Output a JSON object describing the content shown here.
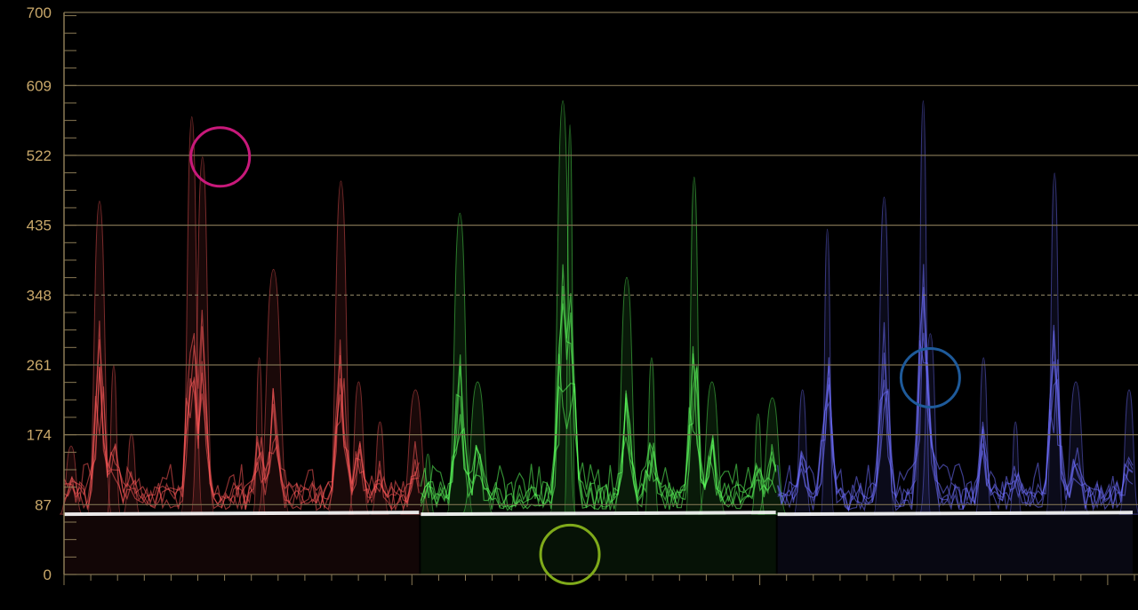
{
  "chart_data": {
    "type": "line",
    "title": "",
    "xlabel": "",
    "ylabel": "",
    "ylim": [
      0,
      700
    ],
    "y_ticks": [
      "0",
      "87",
      "174",
      "261",
      "348",
      "435",
      "522",
      "609",
      "700"
    ],
    "y_tick_values": [
      0,
      87,
      174,
      261,
      348,
      435,
      522,
      609,
      700
    ],
    "reference_line": 348,
    "grid": true,
    "x_range": [
      0,
      1
    ],
    "panels": [
      {
        "channel": "red",
        "color": "#ff5a5a",
        "peaks": [
          {
            "x": 0.02,
            "y": 160
          },
          {
            "x": 0.1,
            "y": 465
          },
          {
            "x": 0.14,
            "y": 260
          },
          {
            "x": 0.19,
            "y": 175
          },
          {
            "x": 0.36,
            "y": 570
          },
          {
            "x": 0.39,
            "y": 520
          },
          {
            "x": 0.55,
            "y": 270
          },
          {
            "x": 0.59,
            "y": 380
          },
          {
            "x": 0.78,
            "y": 490
          },
          {
            "x": 0.83,
            "y": 240
          },
          {
            "x": 0.89,
            "y": 190
          },
          {
            "x": 0.99,
            "y": 230
          }
        ],
        "base": 75,
        "marker": {
          "x": 0.44,
          "y": 520,
          "color": "#c8197a"
        }
      },
      {
        "channel": "green",
        "color": "#5cff5c",
        "peaks": [
          {
            "x": 0.02,
            "y": 150
          },
          {
            "x": 0.11,
            "y": 450
          },
          {
            "x": 0.16,
            "y": 240
          },
          {
            "x": 0.4,
            "y": 590
          },
          {
            "x": 0.42,
            "y": 560
          },
          {
            "x": 0.58,
            "y": 370
          },
          {
            "x": 0.65,
            "y": 270
          },
          {
            "x": 0.77,
            "y": 495
          },
          {
            "x": 0.82,
            "y": 240
          },
          {
            "x": 0.95,
            "y": 200
          },
          {
            "x": 0.99,
            "y": 220
          }
        ],
        "base": 75,
        "marker": {
          "x": 0.42,
          "y": 25,
          "color": "#7faa1a"
        }
      },
      {
        "channel": "blue",
        "color": "#7070ff",
        "peaks": [
          {
            "x": 0.07,
            "y": 230
          },
          {
            "x": 0.14,
            "y": 430
          },
          {
            "x": 0.3,
            "y": 470
          },
          {
            "x": 0.41,
            "y": 590
          },
          {
            "x": 0.43,
            "y": 300
          },
          {
            "x": 0.58,
            "y": 270
          },
          {
            "x": 0.67,
            "y": 190
          },
          {
            "x": 0.78,
            "y": 500
          },
          {
            "x": 0.84,
            "y": 240
          },
          {
            "x": 0.99,
            "y": 230
          }
        ],
        "base": 75,
        "marker": {
          "x": 0.43,
          "y": 245,
          "color": "#1e5a9a"
        }
      }
    ]
  }
}
